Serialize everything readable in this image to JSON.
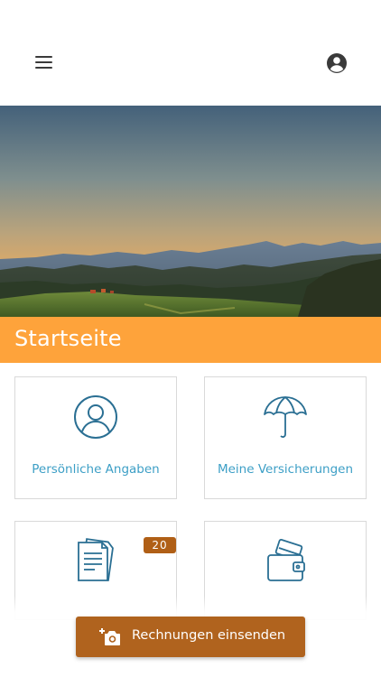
{
  "app": {
    "title": "Startseite"
  },
  "header": {
    "menu_icon": "hamburger-menu-icon",
    "account_icon": "account-circle-icon"
  },
  "hero": {
    "image": "mountain-landscape-photo"
  },
  "tiles": [
    {
      "label": "Persönliche Angaben",
      "icon": "person-circle-icon"
    },
    {
      "label": "Meine Versicherungen",
      "icon": "umbrella-icon"
    },
    {
      "label": "",
      "icon": "documents-icon",
      "badge": "20"
    },
    {
      "label": "",
      "icon": "wallet-card-icon"
    }
  ],
  "action": {
    "label": "Rechnungen einsenden",
    "icon": "add-photo-camera-icon"
  },
  "colors": {
    "accent": "#fea33b",
    "action": "#b0631e",
    "tile_text": "#3d9fc6",
    "icon_stroke": "#2a6f93"
  }
}
